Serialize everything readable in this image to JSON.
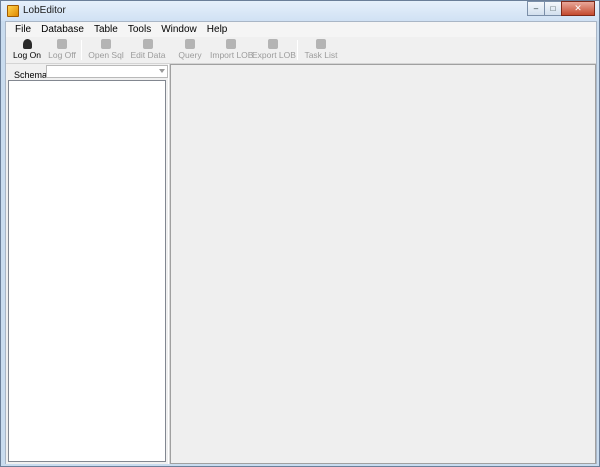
{
  "window": {
    "title": "LobEditor",
    "minimize": "–",
    "maximize": "□",
    "close": "✕"
  },
  "menu": [
    "File",
    "Database",
    "Table",
    "Tools",
    "Window",
    "Help"
  ],
  "toolbar": {
    "log_on": "Log On",
    "log_off": "Log Off",
    "open_sql": "Open Sql",
    "edit_data": "Edit Data",
    "query": "Query",
    "import_lob": "Import LOB",
    "export_lob": "Export LOB",
    "task_list": "Task List"
  },
  "left_pane": {
    "schema_label": "Schema",
    "schema_value": ""
  },
  "icons": {
    "app": "app-icon",
    "log_on": "user-icon",
    "log_off": "user-icon",
    "open_sql": "folder-icon",
    "edit_data": "edit-icon",
    "query": "query-icon",
    "import_lob": "import-icon",
    "export_lob": "export-icon",
    "task_list": "list-icon"
  },
  "colors": {
    "titlebar": "#d0e1f4",
    "client_bg": "#f0f0f0",
    "disabled_text": "#9b9b9b"
  }
}
